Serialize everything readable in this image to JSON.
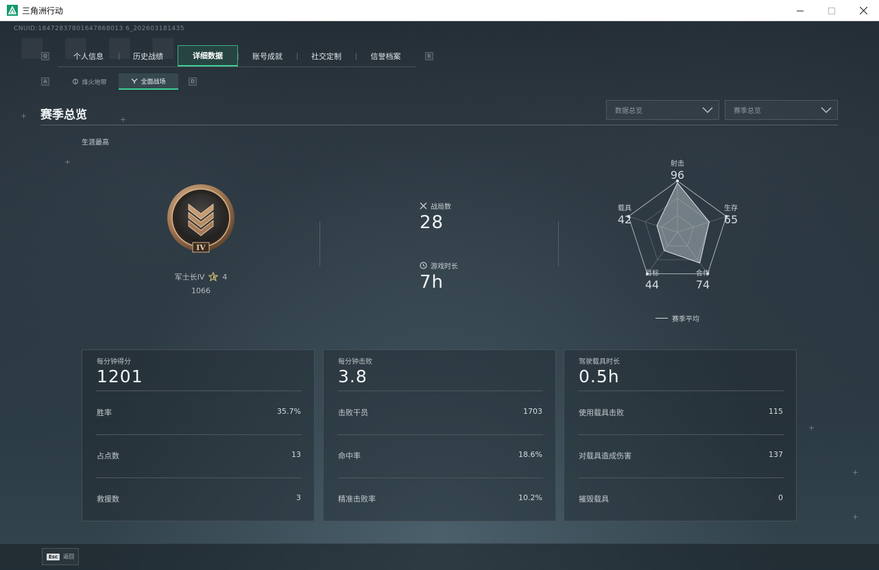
{
  "window": {
    "title": "三角洲行动",
    "controls": [
      "minimize",
      "maximize",
      "close"
    ]
  },
  "uid": "CNUID:18472837801647868013 6_202603181435",
  "nav": {
    "key_left": "Q",
    "key_right": "E",
    "tabs": [
      {
        "label": "个人信息",
        "active": false
      },
      {
        "label": "历史战绩",
        "active": false
      },
      {
        "label": "详细数据",
        "active": true
      },
      {
        "label": "账号成就",
        "active": false
      },
      {
        "label": "社交定制",
        "active": false
      },
      {
        "label": "信誉档案",
        "active": false
      }
    ]
  },
  "subnav": {
    "key_left": "A",
    "key_right": "D",
    "tabs": [
      {
        "label": "烽火地带",
        "active": false
      },
      {
        "label": "全面战场",
        "active": true
      }
    ]
  },
  "section": {
    "title": "赛季总览",
    "dropdown_data": "数据总览",
    "dropdown_season": "赛季总览"
  },
  "career": {
    "label": "生涯最高",
    "rank_name": "军士长IV",
    "rank_roman": "IV",
    "stars": "4",
    "score": "1066"
  },
  "summary": {
    "matches_label": "战局数",
    "matches_value": "28",
    "playtime_label": "游戏时长",
    "playtime_value": "7h"
  },
  "radar": {
    "legend": "赛季平均",
    "axes": [
      {
        "name": "射击",
        "value": 96
      },
      {
        "name": "生存",
        "value": 65
      },
      {
        "name": "合作",
        "value": 74
      },
      {
        "name": "目标",
        "value": 44
      },
      {
        "name": "载具",
        "value": 42
      }
    ]
  },
  "cards": [
    {
      "head_label": "每分钟得分",
      "head_value": "1201",
      "rows": [
        {
          "label": "胜率",
          "value": "35.7%"
        },
        {
          "label": "占点数",
          "value": "13"
        },
        {
          "label": "救援数",
          "value": "3"
        }
      ]
    },
    {
      "head_label": "每分钟击败",
      "head_value": "3.8",
      "rows": [
        {
          "label": "击败干员",
          "value": "1703"
        },
        {
          "label": "命中率",
          "value": "18.6%"
        },
        {
          "label": "精准击败率",
          "value": "10.2%"
        }
      ]
    },
    {
      "head_label": "驾驶载具时长",
      "head_value": "0.5h",
      "rows": [
        {
          "label": "使用载具击败",
          "value": "115"
        },
        {
          "label": "对载具造成伤害",
          "value": "137"
        },
        {
          "label": "摧毁载具",
          "value": "0"
        }
      ]
    }
  ],
  "footer": {
    "esc_key": "Esc",
    "back_label": "返回"
  },
  "colors": {
    "accent": "#3fd096",
    "star": "#d8c27a"
  }
}
